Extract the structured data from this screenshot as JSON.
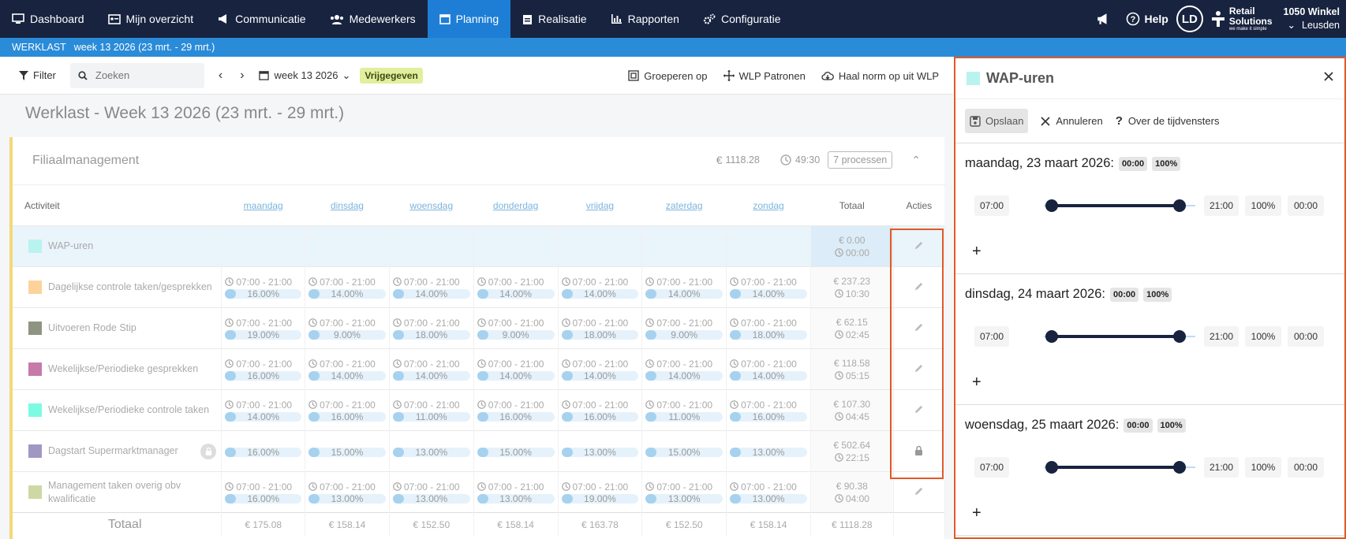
{
  "nav": {
    "items": [
      {
        "label": "Dashboard",
        "icon": "monitor-icon"
      },
      {
        "label": "Mijn overzicht",
        "icon": "id-card-icon"
      },
      {
        "label": "Communicatie",
        "icon": "megaphone-icon"
      },
      {
        "label": "Medewerkers",
        "icon": "users-icon"
      },
      {
        "label": "Planning",
        "icon": "calendar-icon",
        "active": true
      },
      {
        "label": "Realisatie",
        "icon": "clipboard-icon"
      },
      {
        "label": "Rapporten",
        "icon": "bar-chart-icon"
      },
      {
        "label": "Configuratie",
        "icon": "gears-icon"
      }
    ],
    "help": "Help",
    "avatar": "LD",
    "logo_line1": "Retail",
    "logo_line2": "Solutions",
    "logo_sub": "we make it simple",
    "store_line1": "1050 Winkel",
    "store_line2": "Leusden"
  },
  "breadcrumb": {
    "section": "WERKLAST",
    "period": "week 13 2026 (23 mrt. - 29 mrt.)"
  },
  "toolbar": {
    "filter": "Filter",
    "search_placeholder": "Zoeken",
    "week": "week 13 2026",
    "status": "Vrijgegeven",
    "group": "Groeperen op",
    "patterns": "WLP Patronen",
    "fetch": "Haal norm op uit WLP"
  },
  "page_title": "Werklast - Week 13 2026 (23 mrt. - 29 mrt.)",
  "card": {
    "title": "Filiaalmanagement",
    "total_cost": "1118.28",
    "total_hours": "49:30",
    "processes": "7 processen"
  },
  "table": {
    "headers": {
      "activity": "Activiteit",
      "days": [
        "maandag",
        "dinsdag",
        "woensdag",
        "donderdag",
        "vrijdag",
        "zaterdag",
        "zondag"
      ],
      "total": "Totaal",
      "actions": "Acties"
    },
    "rows": [
      {
        "name": "WAP-uren",
        "color": "#b9f3ef",
        "cells": [],
        "cost": "0.00",
        "hours": "00:00",
        "selected": true
      },
      {
        "name": "Dagelijkse controle taken/gesprekken",
        "color": "#fdd39b",
        "time": "07:00 - 21:00",
        "cells": [
          "16.00%",
          "14.00%",
          "14.00%",
          "14.00%",
          "14.00%",
          "14.00%",
          "14.00%"
        ],
        "cost": "237.23",
        "hours": "10:30"
      },
      {
        "name": "Uitvoeren Rode Stip",
        "color": "#8f9482",
        "time": "07:00 - 21:00",
        "cells": [
          "19.00%",
          "9.00%",
          "18.00%",
          "9.00%",
          "18.00%",
          "9.00%",
          "18.00%"
        ],
        "cost": "62.15",
        "hours": "02:45"
      },
      {
        "name": "Wekelijkse/Periodieke gesprekken",
        "color": "#c57aa9",
        "time": "07:00 - 21:00",
        "cells": [
          "16.00%",
          "14.00%",
          "14.00%",
          "14.00%",
          "14.00%",
          "14.00%",
          "14.00%"
        ],
        "cost": "118.58",
        "hours": "05:15"
      },
      {
        "name": "Wekelijkse/Periodieke controle taken",
        "color": "#7bfbe2",
        "time": "07:00 - 21:00",
        "cells": [
          "14.00%",
          "16.00%",
          "11.00%",
          "16.00%",
          "16.00%",
          "11.00%",
          "16.00%"
        ],
        "cost": "107.30",
        "hours": "04:45"
      },
      {
        "name": "Dagstart Supermarktmanager",
        "color": "#a098c2",
        "time": "",
        "cells": [
          "16.00%",
          "15.00%",
          "13.00%",
          "15.00%",
          "13.00%",
          "15.00%",
          "13.00%"
        ],
        "cost": "502.64",
        "hours": "22:15",
        "locked": true
      },
      {
        "name": "Management taken overig obv kwalificatie",
        "color": "#cdd8a4",
        "time": "07:00 - 21:00",
        "cells": [
          "16.00%",
          "13.00%",
          "13.00%",
          "13.00%",
          "19.00%",
          "13.00%",
          "13.00%"
        ],
        "cost": "90.38",
        "hours": "04:00"
      }
    ],
    "totals": {
      "label": "Totaal",
      "values": [
        "175.08",
        "158.14",
        "152.50",
        "158.14",
        "163.78",
        "152.50",
        "158.14"
      ],
      "total": "1118.28"
    }
  },
  "panel": {
    "title": "WAP-uren",
    "color": "#b9f3ef",
    "save": "Opslaan",
    "cancel": "Annuleren",
    "about": "Over de tijdvensters",
    "days": [
      {
        "title": "maandag, 23 maart 2026:",
        "chip1": "00:00",
        "chip2": "100%",
        "start": "07:00",
        "end": "21:00",
        "pct": "100%",
        "dur": "00:00"
      },
      {
        "title": "dinsdag, 24 maart 2026:",
        "chip1": "00:00",
        "chip2": "100%",
        "start": "07:00",
        "end": "21:00",
        "pct": "100%",
        "dur": "00:00"
      },
      {
        "title": "woensdag, 25 maart 2026:",
        "chip1": "00:00",
        "chip2": "100%",
        "start": "07:00",
        "end": "21:00",
        "pct": "100%",
        "dur": "00:00"
      }
    ],
    "add": "+"
  }
}
